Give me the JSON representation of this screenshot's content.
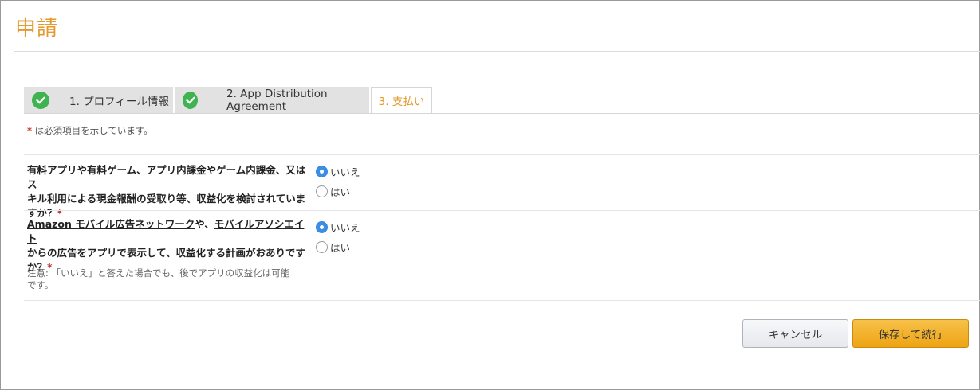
{
  "page": {
    "title": "申請"
  },
  "tabs": [
    {
      "label": "1. プロフィール情報",
      "state": "complete",
      "icon": "check-circle-icon"
    },
    {
      "label": "2. App Distribution Agreement",
      "state": "complete",
      "icon": "check-circle-icon"
    },
    {
      "label": "3. 支払い",
      "state": "active"
    }
  ],
  "required_note": {
    "star": "*",
    "text": " は必須項目を示しています。"
  },
  "questions": [
    {
      "lines": [
        "有料アプリや有料ゲーム、アプリ内課金やゲーム内課金、又はス",
        "キル利用による現金報酬の受取り等、収益化を検討されていま",
        "すか？"
      ],
      "star": "*",
      "options": [
        {
          "label": "いいえ",
          "checked": true
        },
        {
          "label": "はい",
          "checked": false
        }
      ]
    },
    {
      "link1": "Amazon モバイル広告ネットワーク",
      "mid": "や、",
      "link2": "モバイルアソシエイト",
      "lines": [
        "からの広告をアプリで表示して、収益化する計画がおありです",
        "か？"
      ],
      "star": "*",
      "note_lines": [
        "注意: 「いいえ」と答えた場合でも、後でアプリの収益化は可能",
        "です。"
      ],
      "options": [
        {
          "label": "いいえ",
          "checked": true
        },
        {
          "label": "はい",
          "checked": false
        }
      ]
    }
  ],
  "buttons": {
    "cancel": "キャンセル",
    "save": "保存して続行"
  },
  "colors": {
    "accent": "#e39a2d",
    "check": "#3fb34f",
    "radio": "#3a8ee6",
    "save_button": "#f0a81a"
  }
}
